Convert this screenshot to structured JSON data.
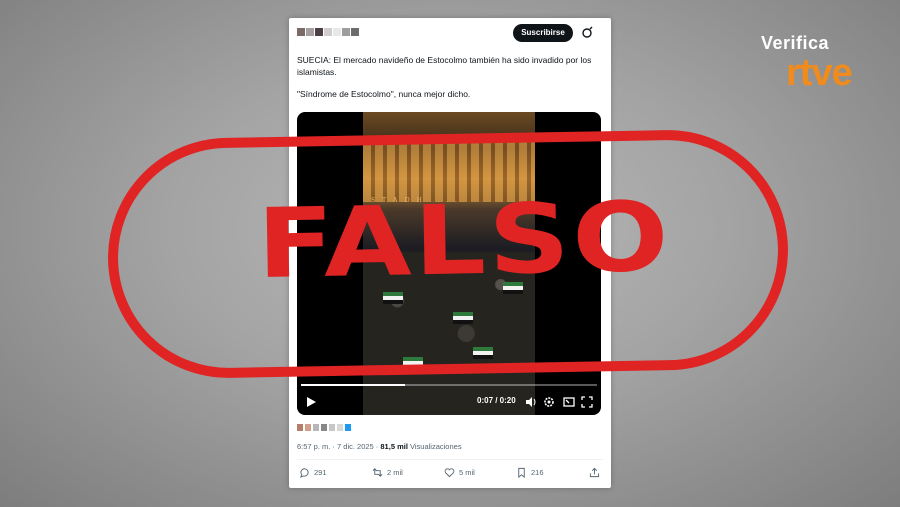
{
  "tweet": {
    "subscribe_label": "Suscribirse",
    "text_line1": "SUECIA: El mercado navideño de Estocolmo también ha sido invadido por los islamistas.",
    "text_line2": "\"Síndrome de Estocolmo\", nunca mejor dicho.",
    "avatar_colors": [
      "#7a6a6a",
      "#a5a0a0",
      "#4b3f45",
      "#cfcfcf",
      "#e8e8e8",
      "#9d9d9d",
      "#6b6b6b"
    ],
    "media_colors": [
      "#b37f6a",
      "#d0a08d",
      "#b7b7b7",
      "#888888",
      "#c7c7c7",
      "#d8d8d8",
      "#1d9bf0"
    ],
    "meta_time": "6:57 p. m. · 7 dic. 2025 · ",
    "meta_views_count": "81,5 mil",
    "meta_views_label": " Visualizaciones",
    "replies": "291",
    "reposts": "2 mil",
    "likes": "5 mil",
    "bookmarks": "216"
  },
  "video": {
    "time": "0:07 / 0:20",
    "sign_text": "STADH ...",
    "progress": 0.35
  },
  "overlay": {
    "stamp": "FALSO",
    "stamp_color": "#e02424"
  },
  "logo": {
    "verifica": "Verifica",
    "rtve": "rtve",
    "brand_color": "#f18b1c"
  }
}
